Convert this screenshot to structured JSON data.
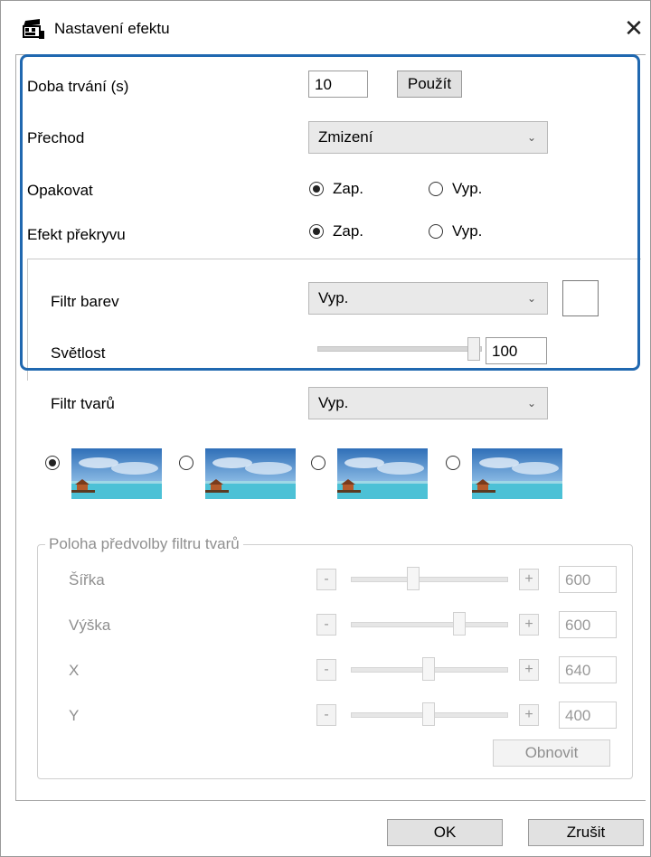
{
  "window": {
    "title": "Nastavení efektu",
    "app_icon": "clapperboard-icon",
    "close_glyph": "✕"
  },
  "duration": {
    "label": "Doba trvání (s)",
    "value": "10",
    "apply_label": "Použít"
  },
  "transition": {
    "label": "Přechod",
    "selected": "Zmizení"
  },
  "repeat": {
    "label": "Opakovat",
    "on_label": "Zap.",
    "off_label": "Vyp.",
    "selected": "on"
  },
  "overlay": {
    "label": "Efekt překryvu",
    "on_label": "Zap.",
    "off_label": "Vyp.",
    "selected": "on"
  },
  "color_filter": {
    "label": "Filtr barev",
    "selected": "Vyp."
  },
  "brightness": {
    "label": "Světlost",
    "value": "100",
    "level": 1.0
  },
  "shape_filter": {
    "label": "Filtr tvarů",
    "selected": "Vyp.",
    "selected_preset": 0
  },
  "shape_position": {
    "title": "Poloha předvolby filtru tvarů",
    "minus_glyph": "-",
    "plus_glyph": "+",
    "rows": [
      {
        "label": "Šířka",
        "value": "600",
        "level": 0.4
      },
      {
        "label": "Výška",
        "value": "600",
        "level": 0.7
      },
      {
        "label": "X",
        "value": "640",
        "level": 0.5
      },
      {
        "label": "Y",
        "value": "400",
        "level": 0.5
      }
    ],
    "reset_label": "Obnovit"
  },
  "footer": {
    "ok_label": "OK",
    "cancel_label": "Zrušit"
  },
  "colors": {
    "highlight_border": "#2068b0",
    "disabled_text": "#8f8f8f"
  }
}
